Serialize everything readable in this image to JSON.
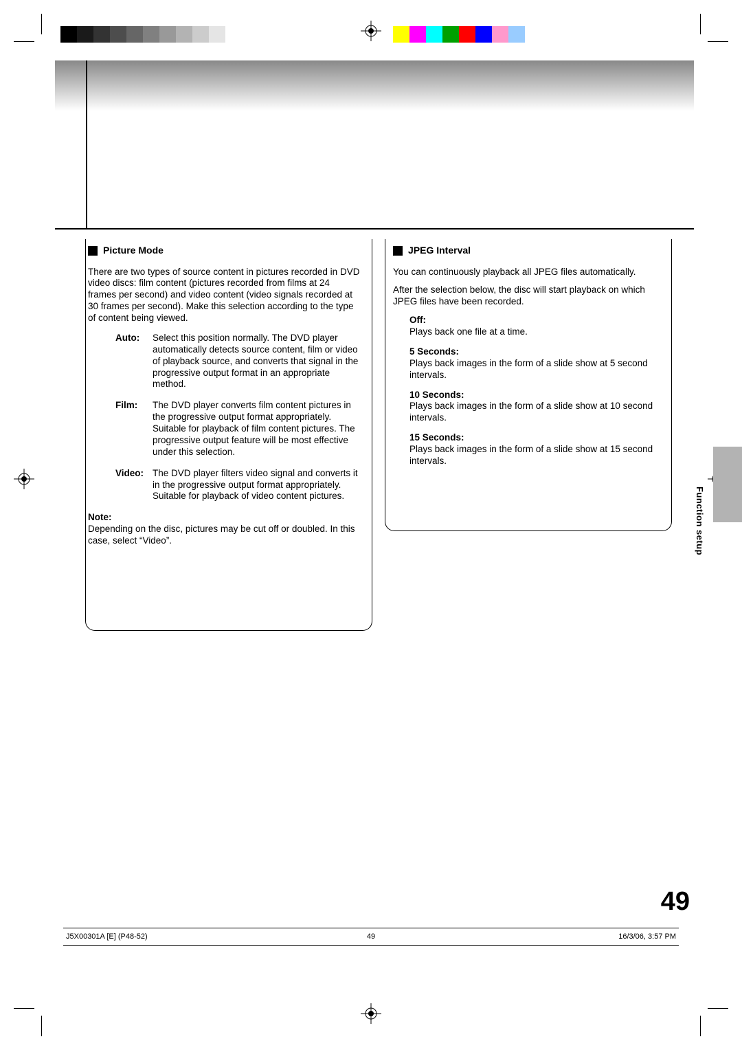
{
  "meta": {
    "section_tab": "Function setup",
    "page_number": "49",
    "slug_left": "J5X00301A [E] (P48-52)",
    "slug_center": "49",
    "slug_right": "16/3/06, 3:57 PM"
  },
  "left": {
    "title": "Picture Mode",
    "intro": "There are two types of source content in pictures recorded in DVD video discs: film content (pictures recorded from films at 24 frames per second) and video content (video signals recorded at 30 frames per second). Make this selection according to the type of content being viewed.",
    "items": [
      {
        "term": "Auto:",
        "body": "Select this position normally.\nThe DVD player automatically detects source content, film or video of playback source, and converts that signal in the progressive output format in an appropriate method."
      },
      {
        "term": "Film:",
        "body": "The DVD player converts film content pictures in the progressive output format appropriately. Suitable for playback of film content pictures. The progressive output feature will be most effective under this selection."
      },
      {
        "term": "Video:",
        "body": "The DVD player filters video signal and converts it in the progressive output format appropriately.\nSuitable for playback of video content pictures."
      }
    ],
    "note_label": "Note:",
    "note_body": "Depending on the disc, pictures may be cut off or doubled. In this case, select “Video”."
  },
  "right": {
    "title": "JPEG Interval",
    "intro1": "You can continuously playback all JPEG files automatically.",
    "intro2": "After the selection below, the disc will start playback on which JPEG files have been recorded.",
    "items": [
      {
        "label": "Off:",
        "body": "Plays back one file at a time."
      },
      {
        "label": "5 Seconds:",
        "body": "Plays back images in the form of a slide show at 5 second intervals."
      },
      {
        "label": "10 Seconds:",
        "body": "Plays back images in the form of a slide show at 10 second intervals."
      },
      {
        "label": "15 Seconds:",
        "body": "Plays back images in the form of a slide show at 15 second intervals."
      }
    ]
  }
}
